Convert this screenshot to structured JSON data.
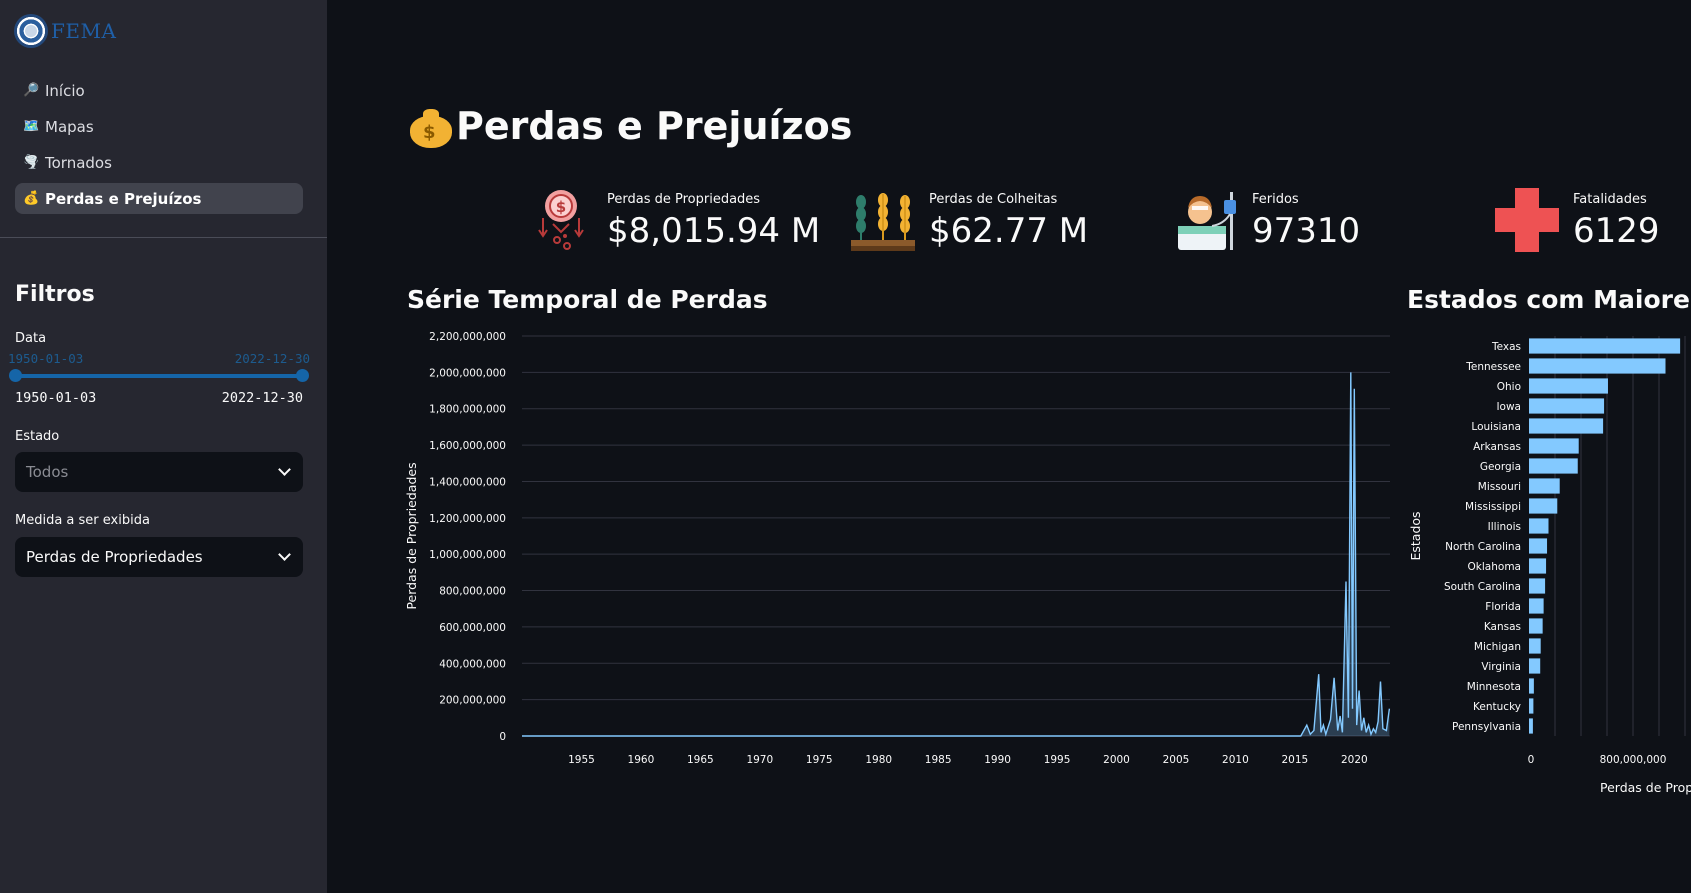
{
  "sidebar": {
    "logo_text": "FEMA",
    "nav": [
      {
        "icon": "🔎",
        "label": "Início",
        "active": false
      },
      {
        "icon": "🗺️",
        "label": "Mapas",
        "active": false
      },
      {
        "icon": "🌪️",
        "label": "Tornados",
        "active": false
      },
      {
        "icon": "💰",
        "label": "Perdas e Prejuízos",
        "active": true
      }
    ],
    "filters_title": "Filtros",
    "date_label": "Data",
    "date_start": "1950-01-03",
    "date_end": "2022-12-30",
    "state_label": "Estado",
    "state_placeholder": "Todos",
    "measure_label": "Medida a ser exibida",
    "measure_value": "Perdas de Propriedades"
  },
  "main": {
    "title": "Perdas e Prejuízos",
    "kpis": [
      {
        "icon": "property-loss-icon",
        "label": "Perdas de Propriedades",
        "value": "$8,015.94 M"
      },
      {
        "icon": "crops-icon",
        "label": "Perdas de Colheitas",
        "value": "$62.77 M"
      },
      {
        "icon": "injured-patient-icon",
        "label": "Feridos",
        "value": "97310"
      },
      {
        "icon": "red-cross-icon",
        "label": "Fatalidades",
        "value": "6129"
      }
    ],
    "timeseries_title": "Série Temporal de Perdas",
    "states_title": "Estados com Maiores Pe"
  },
  "chart_data": [
    {
      "type": "area",
      "title": "Série Temporal de Perdas",
      "xlabel": "",
      "ylabel": "Perdas de Propriedades",
      "ylim": [
        0,
        2200000000
      ],
      "y_ticks": [
        "0",
        "200,000,000",
        "400,000,000",
        "600,000,000",
        "800,000,000",
        "1,000,000,000",
        "1,200,000,000",
        "1,400,000,000",
        "1,600,000,000",
        "1,800,000,000",
        "2,000,000,000",
        "2,200,000,000"
      ],
      "x_ticks": [
        "1955",
        "1960",
        "1965",
        "1970",
        "1975",
        "1980",
        "1985",
        "1990",
        "1995",
        "2000",
        "2005",
        "2010",
        "2015",
        "2020"
      ],
      "xlim": [
        1950.0,
        2023.0
      ],
      "color": "#83c9ff",
      "grid": true,
      "x": [
        1950.0,
        2015.5,
        2016.0,
        2016.3,
        2016.6,
        2017.0,
        2017.2,
        2017.4,
        2017.6,
        2018.0,
        2018.3,
        2018.6,
        2018.8,
        2019.0,
        2019.3,
        2019.5,
        2019.7,
        2019.85,
        2020.0,
        2020.2,
        2020.4,
        2020.6,
        2020.8,
        2021.0,
        2021.2,
        2021.4,
        2021.6,
        2021.8,
        2022.0,
        2022.2,
        2022.4,
        2022.7,
        2022.95
      ],
      "values": [
        0,
        0,
        60000000,
        10000000,
        30000000,
        340000000,
        20000000,
        60000000,
        10000000,
        90000000,
        320000000,
        30000000,
        110000000,
        20000000,
        850000000,
        100000000,
        2000000000,
        150000000,
        1910000000,
        60000000,
        250000000,
        30000000,
        100000000,
        20000000,
        60000000,
        10000000,
        40000000,
        20000000,
        80000000,
        300000000,
        40000000,
        30000000,
        150000000
      ]
    },
    {
      "type": "bar",
      "orientation": "horizontal",
      "title": "Estados com Maiores Pe",
      "xlabel": "Perdas de Propr",
      "ylabel": "Estados",
      "x_ticks": [
        "0",
        "800,000,000"
      ],
      "xlim": [
        0,
        4000000000
      ],
      "color": "#83c9ff",
      "categories": [
        "Texas",
        "Tennessee",
        "Ohio",
        "Iowa",
        "Louisiana",
        "Arkansas",
        "Georgia",
        "Missouri",
        "Mississippi",
        "Illinois",
        "North Carolina",
        "Oklahoma",
        "South Carolina",
        "Florida",
        "Kansas",
        "Michigan",
        "Virginia",
        "Minnesota",
        "Kentucky",
        "Pennsylvania"
      ],
      "values": [
        1550000000,
        1400000000,
        810000000,
        770000000,
        760000000,
        510000000,
        500000000,
        315000000,
        290000000,
        200000000,
        185000000,
        175000000,
        165000000,
        150000000,
        140000000,
        120000000,
        115000000,
        50000000,
        45000000,
        40000000
      ]
    }
  ]
}
